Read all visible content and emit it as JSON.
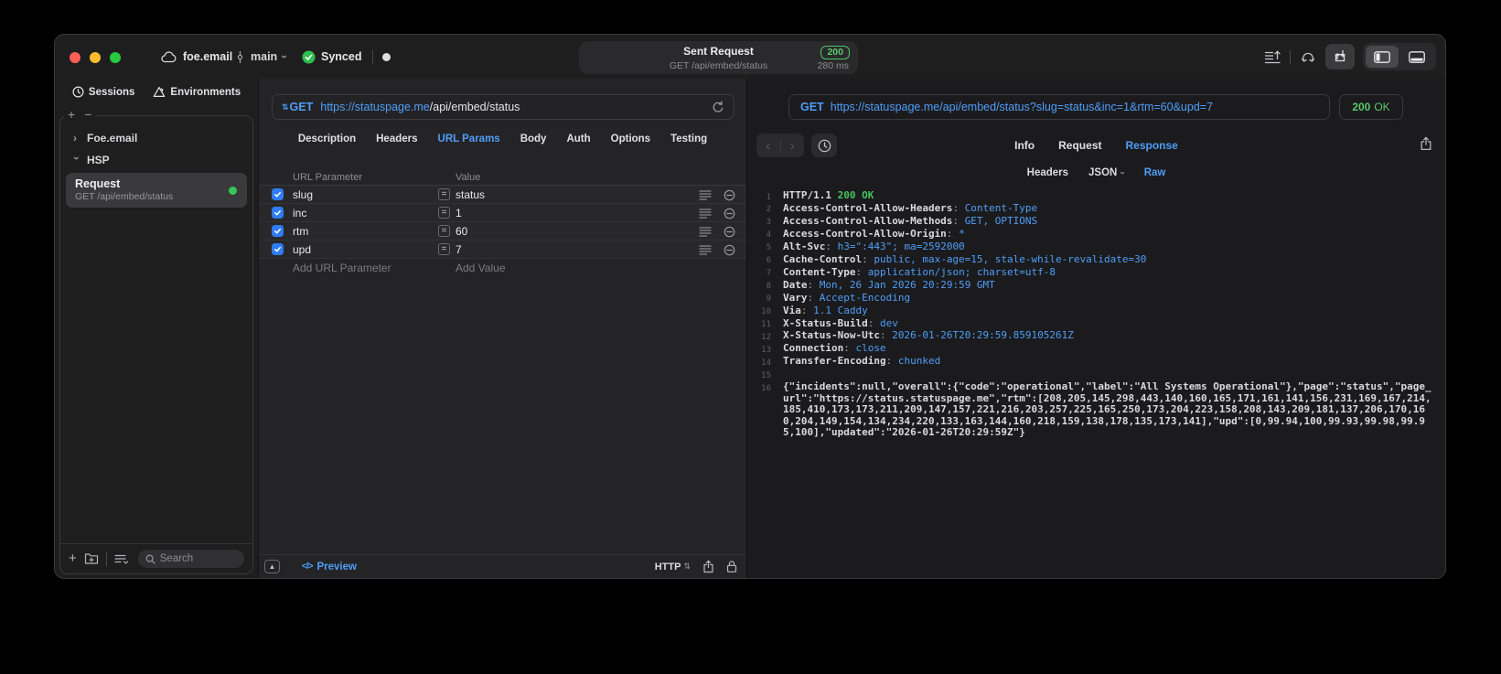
{
  "titlebar": {
    "project": "foe.email",
    "branch": "main",
    "sync_label": "Synced",
    "request_pill": {
      "title": "Sent Request",
      "status": "200",
      "method_path": "GET /api/embed/status",
      "duration": "280 ms"
    }
  },
  "sidebar": {
    "tabs": {
      "sessions": "Sessions",
      "environments": "Environments"
    },
    "tree": [
      {
        "label": "Foe.email"
      },
      {
        "label": "HSP"
      }
    ],
    "request_item": {
      "title": "Request",
      "subtitle": "GET /api/embed/status"
    },
    "search_placeholder": "Search"
  },
  "request_panel": {
    "method": "GET",
    "url_host": "https://statuspage.me",
    "url_path": "/api/embed/status",
    "tabs": [
      "Description",
      "Headers",
      "URL Params",
      "Body",
      "Auth",
      "Options",
      "Testing"
    ],
    "active_tab": "URL Params",
    "params": {
      "col_name": "URL Parameter",
      "col_value": "Value",
      "rows": [
        {
          "name": "slug",
          "value": "status",
          "enabled": true
        },
        {
          "name": "inc",
          "value": "1",
          "enabled": true
        },
        {
          "name": "rtm",
          "value": "60",
          "enabled": true
        },
        {
          "name": "upd",
          "value": "7",
          "enabled": true
        }
      ],
      "add_name": "Add URL Parameter",
      "add_value": "Add Value"
    },
    "footer": {
      "preview": "Preview",
      "protocol": "HTTP"
    }
  },
  "response_panel": {
    "method": "GET",
    "url": "https://statuspage.me/api/embed/status?slug=status&inc=1&rtm=60&upd=7",
    "status_code": "200",
    "status_text": "OK",
    "tabs": [
      "Info",
      "Request",
      "Response"
    ],
    "active_tab": "Response",
    "view_tabs": [
      "Headers",
      "JSON",
      "Raw"
    ],
    "active_view": "Raw",
    "body_lines": [
      {
        "n": "1",
        "parts": [
          [
            "HTTP/1.1 ",
            "w"
          ],
          [
            "200 OK",
            "g"
          ]
        ]
      },
      {
        "n": "2",
        "parts": [
          [
            "Access-Control-Allow-Headers",
            "w"
          ],
          [
            ": ",
            "d"
          ],
          [
            "Content-Type",
            "b"
          ]
        ]
      },
      {
        "n": "3",
        "parts": [
          [
            "Access-Control-Allow-Methods",
            "w"
          ],
          [
            ": ",
            "d"
          ],
          [
            "GET, OPTIONS",
            "b"
          ]
        ]
      },
      {
        "n": "4",
        "parts": [
          [
            "Access-Control-Allow-Origin",
            "w"
          ],
          [
            ": ",
            "d"
          ],
          [
            "*",
            "b"
          ]
        ]
      },
      {
        "n": "5",
        "parts": [
          [
            "Alt-Svc",
            "w"
          ],
          [
            ": ",
            "d"
          ],
          [
            "h3=\":443\"; ma=2592000",
            "b"
          ]
        ]
      },
      {
        "n": "6",
        "parts": [
          [
            "Cache-Control",
            "w"
          ],
          [
            ": ",
            "d"
          ],
          [
            "public, max-age=15, stale-while-revalidate=30",
            "b"
          ]
        ]
      },
      {
        "n": "7",
        "parts": [
          [
            "Content-Type",
            "w"
          ],
          [
            ": ",
            "d"
          ],
          [
            "application/json; charset=utf-8",
            "b"
          ]
        ]
      },
      {
        "n": "8",
        "parts": [
          [
            "Date",
            "w"
          ],
          [
            ": ",
            "d"
          ],
          [
            "Mon, 26 Jan 2026 20:29:59 GMT",
            "b"
          ]
        ]
      },
      {
        "n": "9",
        "parts": [
          [
            "Vary",
            "w"
          ],
          [
            ": ",
            "d"
          ],
          [
            "Accept-Encoding",
            "b"
          ]
        ]
      },
      {
        "n": "10",
        "parts": [
          [
            "Via",
            "w"
          ],
          [
            ": ",
            "d"
          ],
          [
            "1.1 Caddy",
            "b"
          ]
        ]
      },
      {
        "n": "11",
        "parts": [
          [
            "X-Status-Build",
            "w"
          ],
          [
            ": ",
            "d"
          ],
          [
            "dev",
            "b"
          ]
        ]
      },
      {
        "n": "12",
        "parts": [
          [
            "X-Status-Now-Utc",
            "w"
          ],
          [
            ": ",
            "d"
          ],
          [
            "2026-01-26T20:29:59.859105261Z",
            "b"
          ]
        ]
      },
      {
        "n": "13",
        "parts": [
          [
            "Connection",
            "w"
          ],
          [
            ": ",
            "d"
          ],
          [
            "close",
            "b"
          ]
        ]
      },
      {
        "n": "14",
        "parts": [
          [
            "Transfer-Encoding",
            "w"
          ],
          [
            ": ",
            "d"
          ],
          [
            "chunked",
            "b"
          ]
        ]
      },
      {
        "n": "15",
        "parts": []
      },
      {
        "n": "16",
        "parts": [
          [
            "{\"incidents\":null,\"overall\":{\"code\":\"operational\",\"label\":\"All Systems Operational\"},\"page\":\"status\",\"page_url\":\"https://status.statuspage.me\",\"rtm\":[208,205,145,298,443,140,160,165,171,161,141,156,231,169,167,214,185,410,173,173,211,209,147,157,221,216,203,257,225,165,250,173,204,223,158,208,143,209,181,137,206,170,160,204,149,154,134,234,220,133,163,144,160,218,159,138,178,135,173,141],\"upd\":[0,99.94,100,99.93,99.98,99.95,100],\"updated\":\"2026-01-26T20:29:59Z\"}",
            "w"
          ]
        ]
      }
    ]
  },
  "colors": {
    "accent_blue": "#4f9ef8",
    "status_green": "#4ec463",
    "checkbox_blue": "#2f7cf6"
  }
}
